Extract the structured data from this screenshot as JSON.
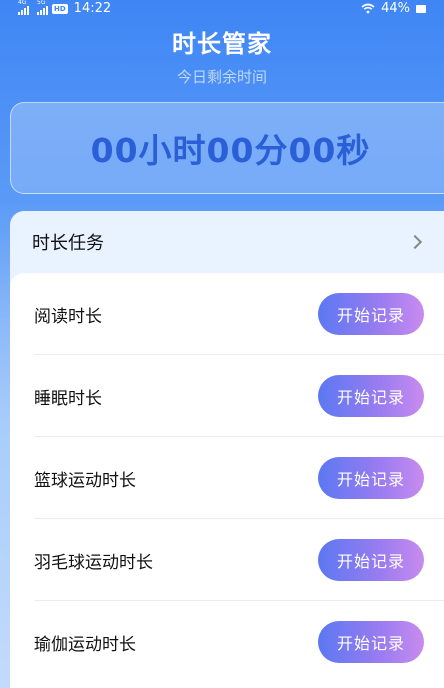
{
  "status_bar": {
    "network1": "4G",
    "network2": "5G",
    "hd_badge": "HD",
    "time": "14:22",
    "battery": "44%"
  },
  "header": {
    "title": "时长管家",
    "subtitle": "今日剩余时间"
  },
  "timer": {
    "display": "00小时00分00秒"
  },
  "tasks": {
    "section_title": "时长任务",
    "items": [
      {
        "name": "阅读时长",
        "button": "开始记录"
      },
      {
        "name": "睡眠时长",
        "button": "开始记录"
      },
      {
        "name": "篮球运动时长",
        "button": "开始记录"
      },
      {
        "name": "羽毛球运动时长",
        "button": "开始记录"
      },
      {
        "name": "瑜伽运动时长",
        "button": "开始记录"
      }
    ]
  },
  "icons": {
    "signal": "signal-icon",
    "wifi": "wifi-icon",
    "battery": "battery-icon",
    "chevron": "chevron-right-icon"
  }
}
